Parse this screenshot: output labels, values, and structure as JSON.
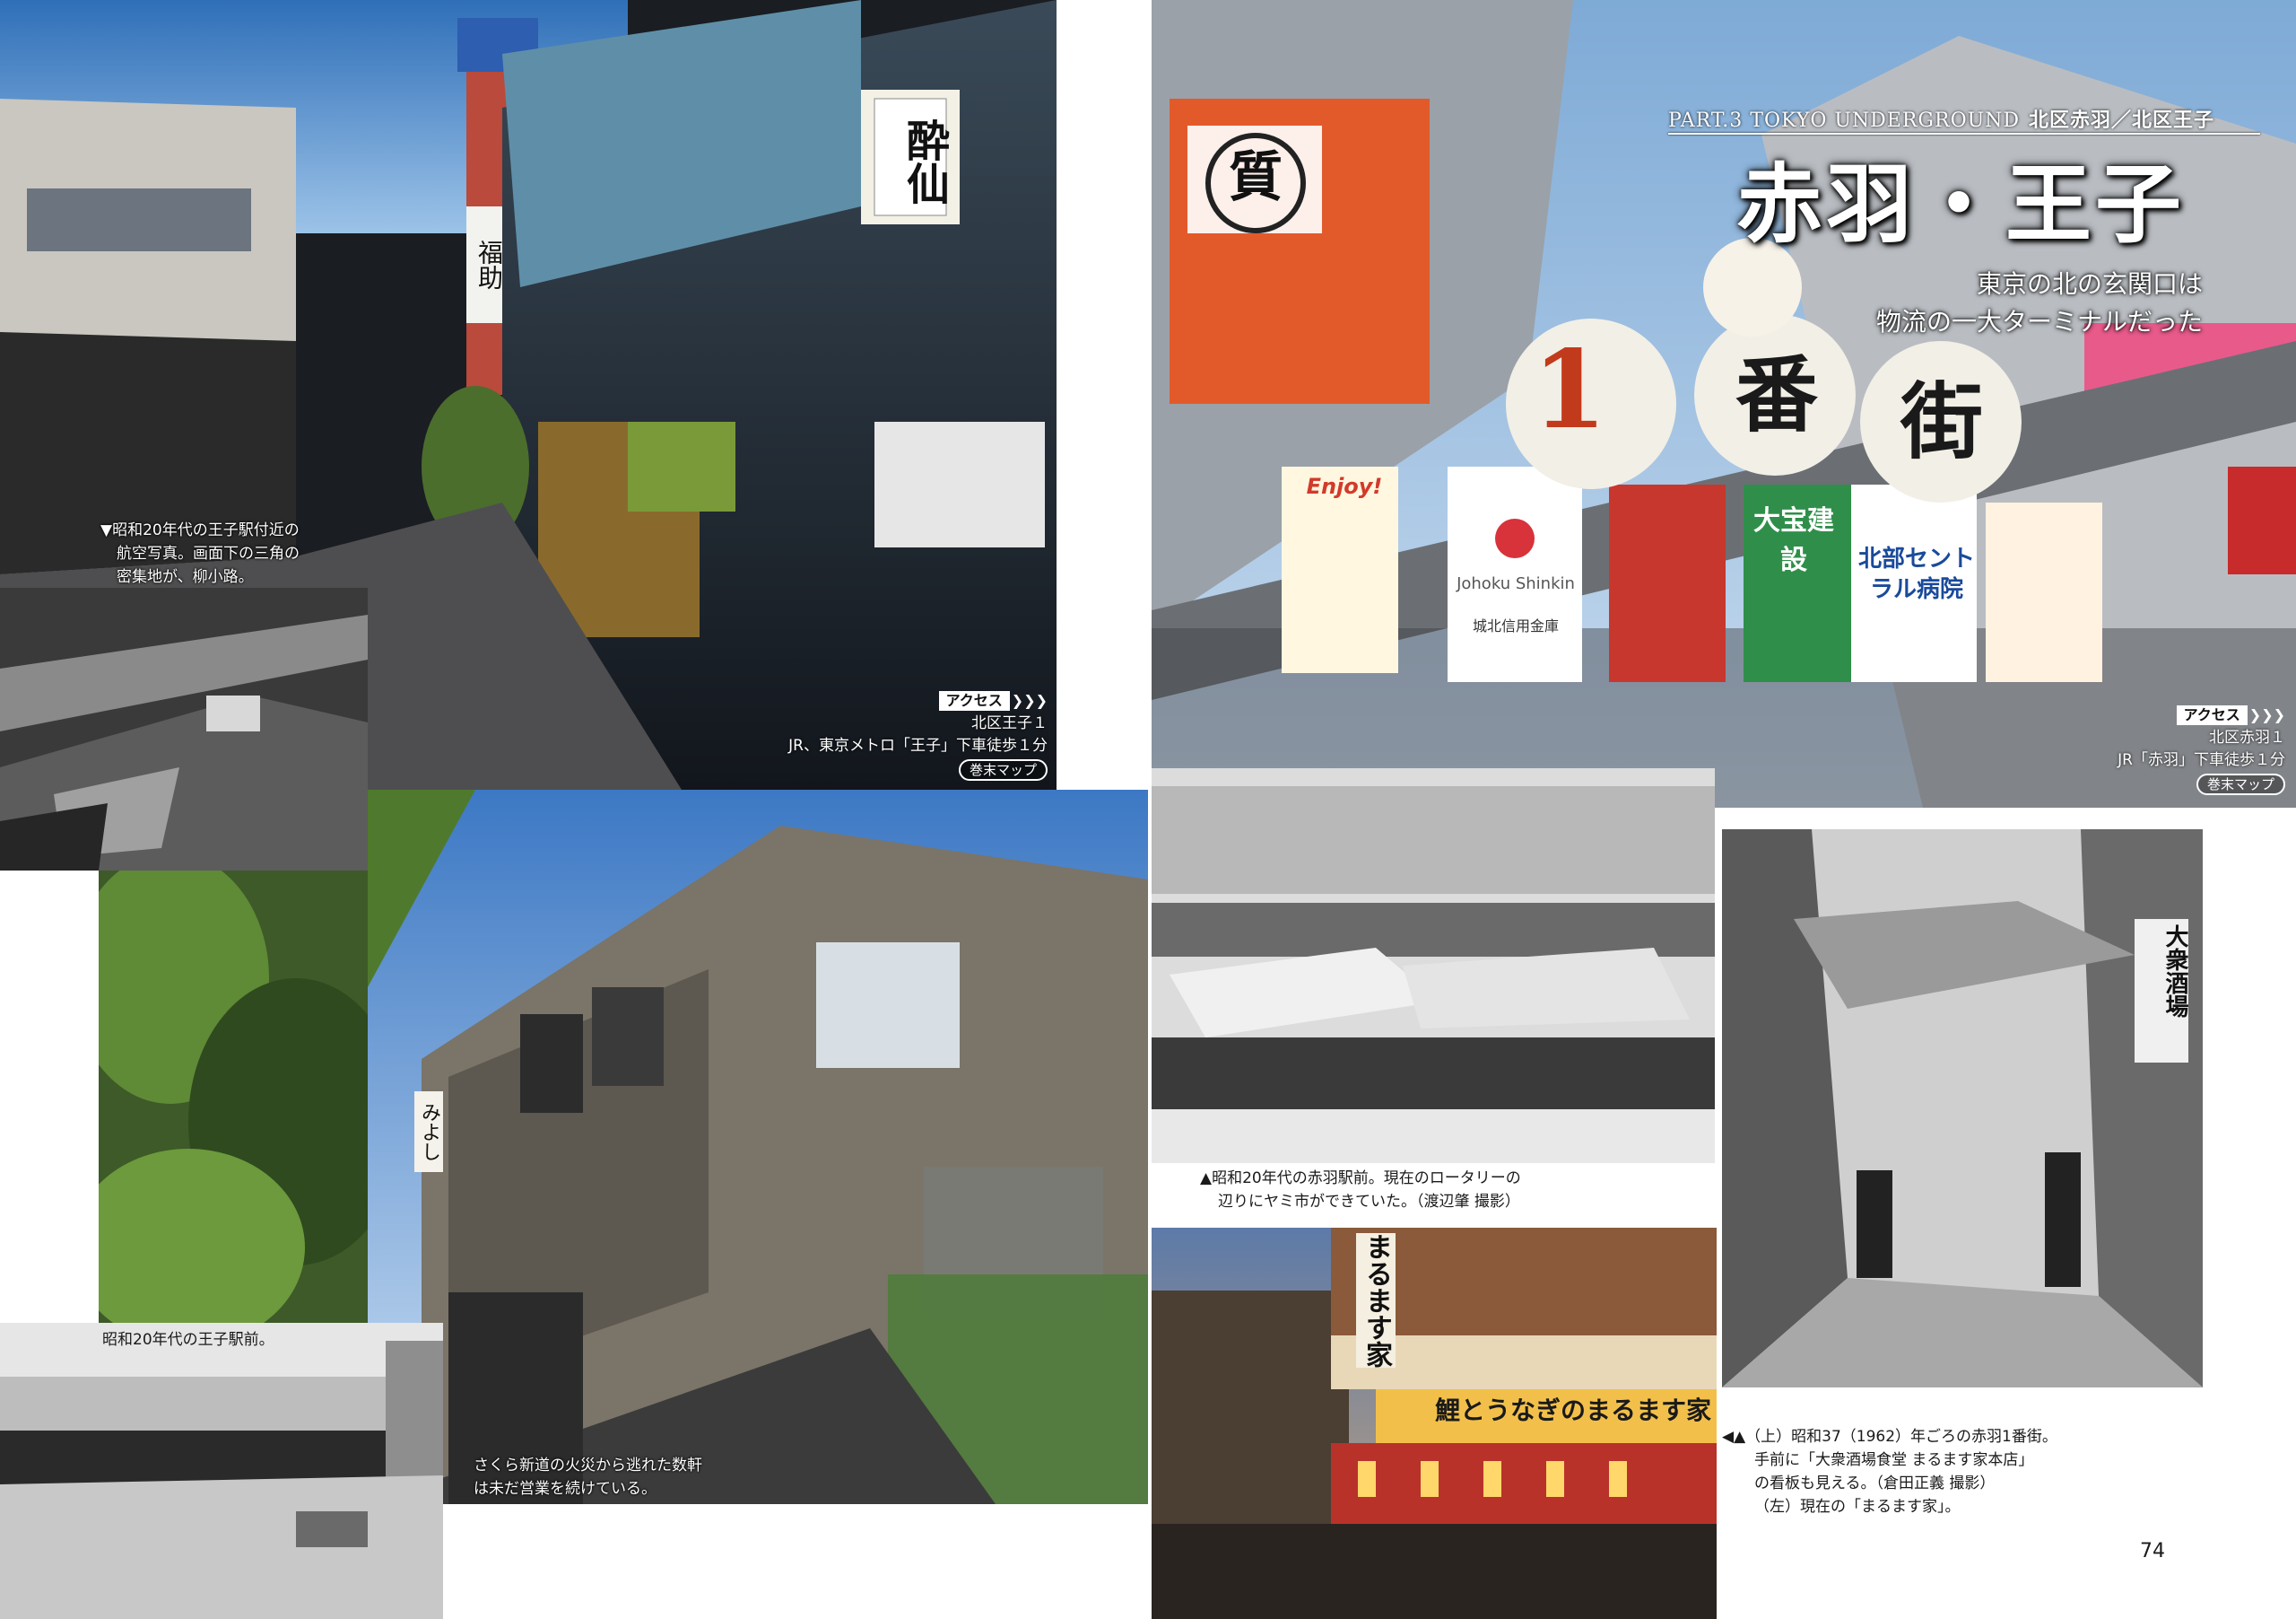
{
  "title_block": {
    "part_en": "PART.3 TOKYO UNDERGROUND",
    "part_jp": "北区赤羽／北区王子",
    "title": "赤羽・王子",
    "subtitle_lines": [
      "東京の北の玄関口は",
      "物流の一大ターミナルだった"
    ]
  },
  "captions": {
    "aerial": [
      "▼昭和20年代の王子駅付近の",
      "航空写真。画面下の三角の",
      "密集地が、柳小路。"
    ],
    "oji_station": "昭和20年代の王子駅前。",
    "sakura": [
      "さくら新道の火災から逃れた数軒",
      "は未だ営業を続けている。"
    ],
    "akabane_station": [
      "▲昭和20年代の赤羽駅前。現在のロータリーの",
      "辺りにヤミ市ができていた。（渡辺肇 撮影）"
    ],
    "ichibangai": [
      "◀▲（上）昭和37（1962）年ごろの赤羽1番街。",
      "手前に「大衆酒場食堂 まるます家本店」",
      "の看板も見える。（倉田正義 撮影）",
      "（左）現在の「まるます家」。"
    ]
  },
  "access_oji": {
    "tag": "アクセス",
    "lines": [
      "北区王子１",
      "JR、東京メトロ「王子」下車徒歩１分"
    ],
    "map": "巻末マップ"
  },
  "access_akabane": {
    "tag": "アクセス",
    "lines": [
      "北区赤羽１",
      "JR「赤羽」下車徒歩１分"
    ],
    "map": "巻末マップ"
  },
  "signs": {
    "suizan": "酔仙",
    "fukusuke": "福助",
    "ichiban": "1",
    "ban": "番",
    "gai": "街",
    "shichi": "質",
    "miyoshi": "みよし",
    "marumasu": "まるます家",
    "koi_unagi": "鯉とうなぎのまるます家",
    "taishu": "大衆酒場",
    "shinkin": "城北信用金庫",
    "hospital": "北部セントラル病院",
    "kensetsu": "大宝建設",
    "enjoy": "Enjoy!",
    "johoku": "Johoku Shinkin"
  },
  "page": {
    "number": "74"
  },
  "colors": {
    "title_text": "#ffffff",
    "access_tag_bg": "#ffffff"
  }
}
